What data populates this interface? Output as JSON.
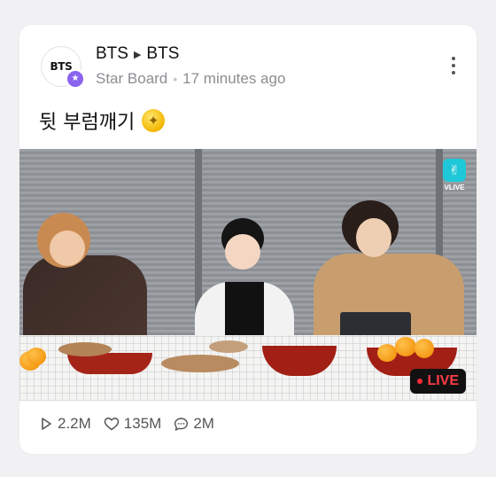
{
  "header": {
    "avatar_text": "BTS",
    "channel_from": "BTS",
    "channel_to": "BTS",
    "board": "Star Board",
    "time": "17 minutes ago"
  },
  "post": {
    "text": "뒷 부럼깨기"
  },
  "video": {
    "logo_text": "VLIVE",
    "live_label": "LIVE"
  },
  "stats": {
    "plays": "2.2M",
    "likes": "135M",
    "comments": "2M"
  },
  "colors": {
    "accent": "#8a63ee",
    "live_red": "#ff3b48",
    "vlive_teal": "#1ec8d8"
  }
}
